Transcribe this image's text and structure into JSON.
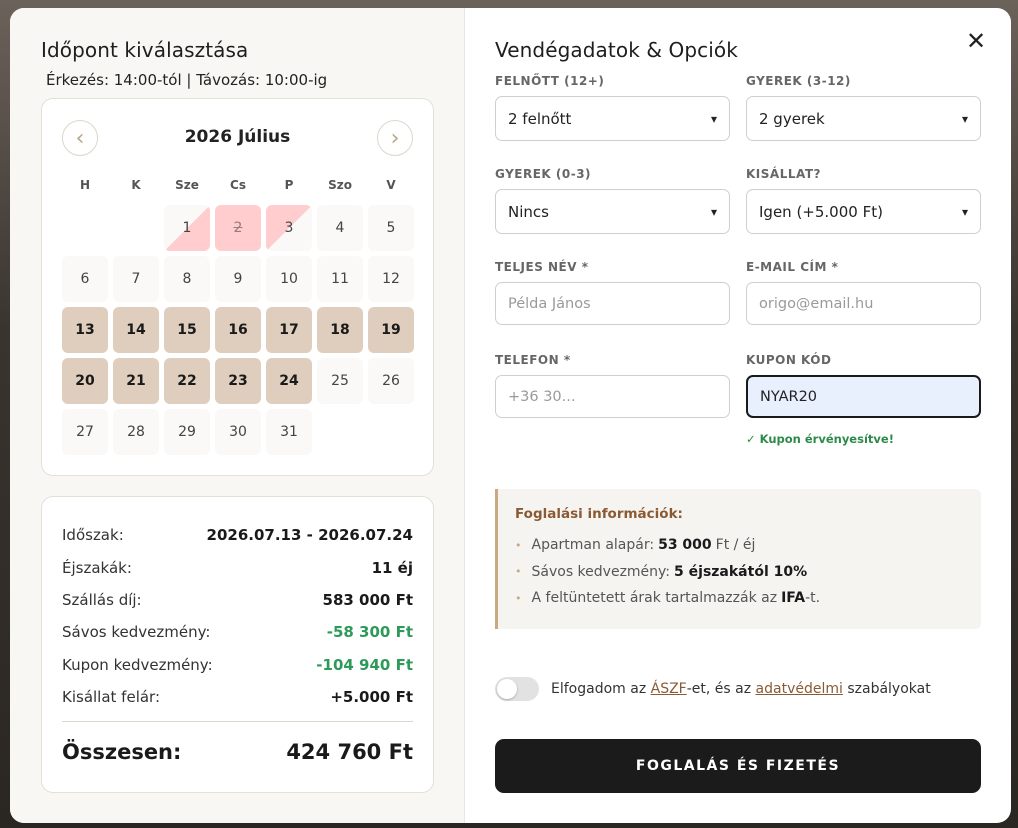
{
  "left": {
    "title": "Időpont kiválasztása",
    "times": "Érkezés: 14:00-tól | Távozás: 10:00-ig"
  },
  "calendar": {
    "title": "2026 Július",
    "prev": "‹",
    "next": "›",
    "weekdays": [
      "H",
      "K",
      "Sze",
      "Cs",
      "P",
      "Szo",
      "V"
    ],
    "leading_empty": 2,
    "days": [
      {
        "n": "1",
        "state": "half-in"
      },
      {
        "n": "2",
        "state": "booked"
      },
      {
        "n": "3",
        "state": "half-out"
      },
      {
        "n": "4",
        "state": "free"
      },
      {
        "n": "5",
        "state": "free"
      },
      {
        "n": "6",
        "state": "free"
      },
      {
        "n": "7",
        "state": "free"
      },
      {
        "n": "8",
        "state": "free"
      },
      {
        "n": "9",
        "state": "free"
      },
      {
        "n": "10",
        "state": "free"
      },
      {
        "n": "11",
        "state": "free"
      },
      {
        "n": "12",
        "state": "free"
      },
      {
        "n": "13",
        "state": "selected"
      },
      {
        "n": "14",
        "state": "selected"
      },
      {
        "n": "15",
        "state": "selected"
      },
      {
        "n": "16",
        "state": "selected"
      },
      {
        "n": "17",
        "state": "selected"
      },
      {
        "n": "18",
        "state": "selected"
      },
      {
        "n": "19",
        "state": "selected"
      },
      {
        "n": "20",
        "state": "selected"
      },
      {
        "n": "21",
        "state": "selected"
      },
      {
        "n": "22",
        "state": "selected"
      },
      {
        "n": "23",
        "state": "selected"
      },
      {
        "n": "24",
        "state": "selected"
      },
      {
        "n": "25",
        "state": "free"
      },
      {
        "n": "26",
        "state": "free"
      },
      {
        "n": "27",
        "state": "free"
      },
      {
        "n": "28",
        "state": "free"
      },
      {
        "n": "29",
        "state": "free"
      },
      {
        "n": "30",
        "state": "free"
      },
      {
        "n": "31",
        "state": "free"
      }
    ]
  },
  "summary": {
    "rows": [
      {
        "label": "Időszak:",
        "value": "2026.07.13 - 2026.07.24",
        "green": false
      },
      {
        "label": "Éjszakák:",
        "value": "11 éj",
        "green": false
      },
      {
        "label": "Szállás díj:",
        "value": "583 000 Ft",
        "green": false
      },
      {
        "label": "Sávos kedvezmény:",
        "value": "-58 300 Ft",
        "green": true
      },
      {
        "label": "Kupon kedvezmény:",
        "value": "-104 940 Ft",
        "green": true
      },
      {
        "label": "Kisállat felár:",
        "value": "+5.000 Ft",
        "green": false
      }
    ],
    "total_label": "Összesen:",
    "total_value": "424 760 Ft"
  },
  "right": {
    "title": "Vendégadatok & Opciók",
    "close": "✕"
  },
  "form": {
    "adults_label": "FELNŐTT (12+)",
    "adults_value": "2 felnőtt",
    "children_label": "GYEREK (3-12)",
    "children_value": "2 gyerek",
    "infants_label": "GYEREK (0-3)",
    "infants_value": "Nincs",
    "pet_label": "KISÁLLAT?",
    "pet_value": "Igen (+5.000 Ft)",
    "name_label": "TELJES NÉV *",
    "name_placeholder": "Példa János",
    "email_label": "E-MAIL CÍM *",
    "email_placeholder": "origo@email.hu",
    "phone_label": "TELEFON *",
    "phone_placeholder": "+36 30...",
    "coupon_label": "KUPON KÓD",
    "coupon_value": "NYAR20",
    "coupon_ok": "✓ Kupon érvényesítve!"
  },
  "info": {
    "title": "Foglalási információk:",
    "i1_pre": "Apartman alapár:",
    "i1_bold": "53 000",
    "i1_post": "Ft / éj",
    "i2_pre": "Sávos kedvezmény:",
    "i2_bold": "5 éjszakától 10%",
    "i3_pre": "A feltüntetett árak tartalmazzák az",
    "i3_bold": "IFA",
    "i3_post": "-t."
  },
  "terms": {
    "pre": "Elfogadom az ",
    "link1": "ÁSZF",
    "mid": "-et, és az ",
    "link2": "adatvédelmi",
    "post": " szabályokat"
  },
  "submit_label": "FOGLALÁS ÉS FIZETÉS"
}
